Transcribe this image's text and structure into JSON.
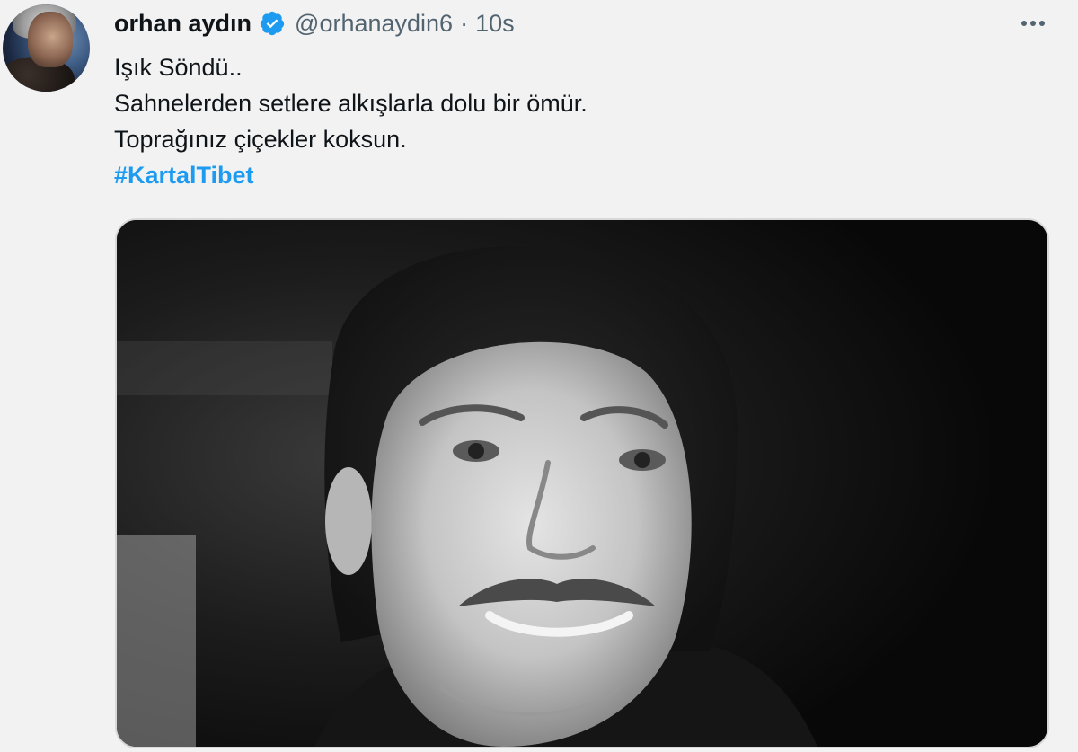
{
  "tweet": {
    "display_name": "orhan aydın",
    "handle": "@orhanaydin6",
    "separator": "·",
    "time": "10s",
    "lines": [
      "Işık Söndü..",
      "Sahnelerden setlere alkışlarla dolu bir ömür.",
      "Toprağınız çiçekler koksun."
    ],
    "hashtag": "#KartalTibet"
  },
  "icons": {
    "verified": "verified-badge-icon",
    "more": "more-options-icon"
  },
  "colors": {
    "background": "#f2f2f2",
    "text": "#0f1419",
    "secondary": "#536471",
    "accent": "#1d9bf0"
  }
}
